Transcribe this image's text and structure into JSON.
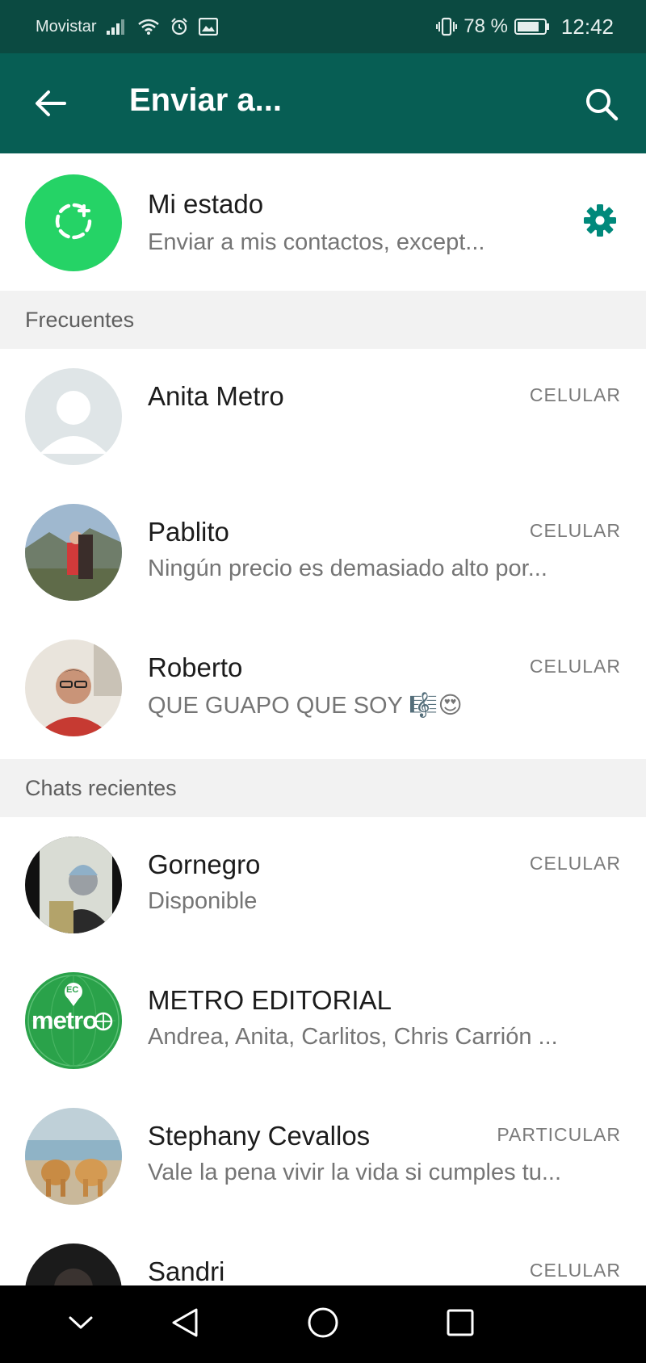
{
  "status_bar": {
    "carrier": "Movistar",
    "battery_percent": "78 %",
    "time": "12:42",
    "icons": [
      "signal-icon",
      "wifi-icon",
      "alarm-icon",
      "gallery-icon",
      "vibrate-icon",
      "battery-icon"
    ]
  },
  "app_bar": {
    "title": "Enviar a...",
    "back_icon": "arrow-back-icon",
    "search_icon": "search-icon"
  },
  "my_status": {
    "name": "Mi estado",
    "subtitle": "Enviar a mis contactos, except...",
    "avatar_icon": "status-add-icon",
    "settings_icon": "gear-icon"
  },
  "sections": {
    "frequent": "Frecuentes",
    "recent": "Chats recientes"
  },
  "frequent_contacts": [
    {
      "name": "Anita Metro",
      "status": "",
      "type": "CELULAR"
    },
    {
      "name": "Pablito",
      "status": "Ningún precio es demasiado alto por...",
      "type": "CELULAR"
    },
    {
      "name": "Roberto",
      "status": "QUE GUAPO QUE SOY 🎼😍",
      "type": "CELULAR"
    }
  ],
  "recent_chats": [
    {
      "name": "Gornegro",
      "status": "Disponible",
      "type": "CELULAR"
    },
    {
      "name": "METRO EDITORIAL",
      "status": "Andrea, Anita, Carlitos, Chris Carrión ...",
      "type": ""
    },
    {
      "name": "Stephany Cevallos",
      "status": "Vale la pena vivir la vida si cumples tu...",
      "type": "PARTICULAR"
    },
    {
      "name": "Sandri",
      "status": "",
      "type": "CELULAR"
    }
  ],
  "metro_logo_text": "metro",
  "metro_logo_badge": "EC",
  "nav_bar": {
    "icons": [
      "chevron-down-icon",
      "back-triangle-icon",
      "home-circle-icon",
      "recents-square-icon"
    ]
  },
  "colors": {
    "status_bar": "#0b4a41",
    "app_bar": "#075e54",
    "accent_green": "#25d366",
    "teal_icon": "#00897b"
  }
}
